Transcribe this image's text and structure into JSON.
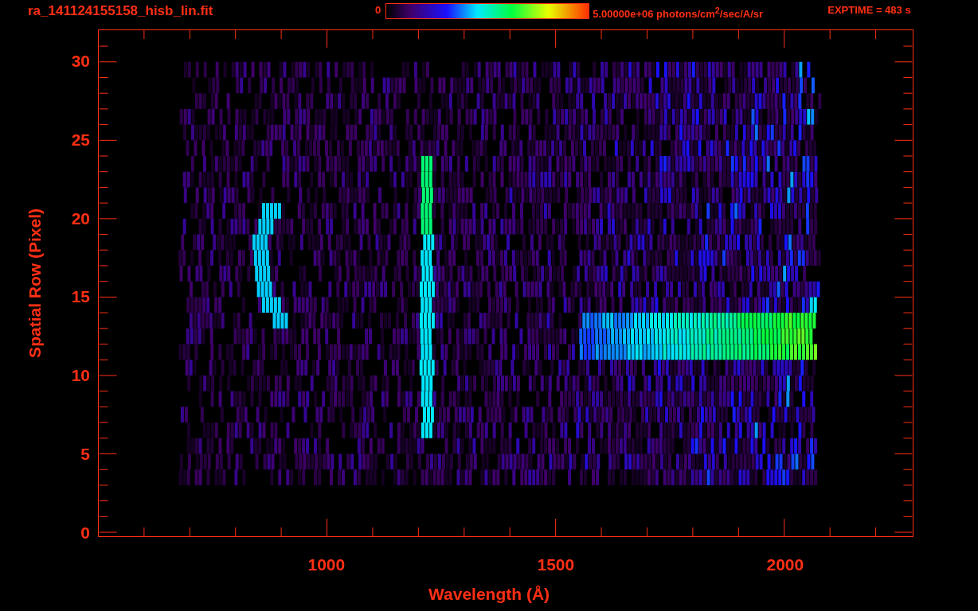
{
  "title": "ra_141124155158_hisb_lin.fit",
  "colorbar": {
    "min_label": "0",
    "max_label": "5.00000e+06 photons/cm$^{2}$/sec/A/sr"
  },
  "exposure": "EXPTIME = 483 s",
  "y_axis": {
    "label": "Spatial Row (Pixel)",
    "ticks": [
      "30",
      "25",
      "20",
      "15",
      "10",
      "5",
      "0"
    ]
  },
  "x_axis": {
    "label": "Wavelength (Å)",
    "ticks": [
      "1000",
      "1500",
      "2000"
    ]
  }
}
